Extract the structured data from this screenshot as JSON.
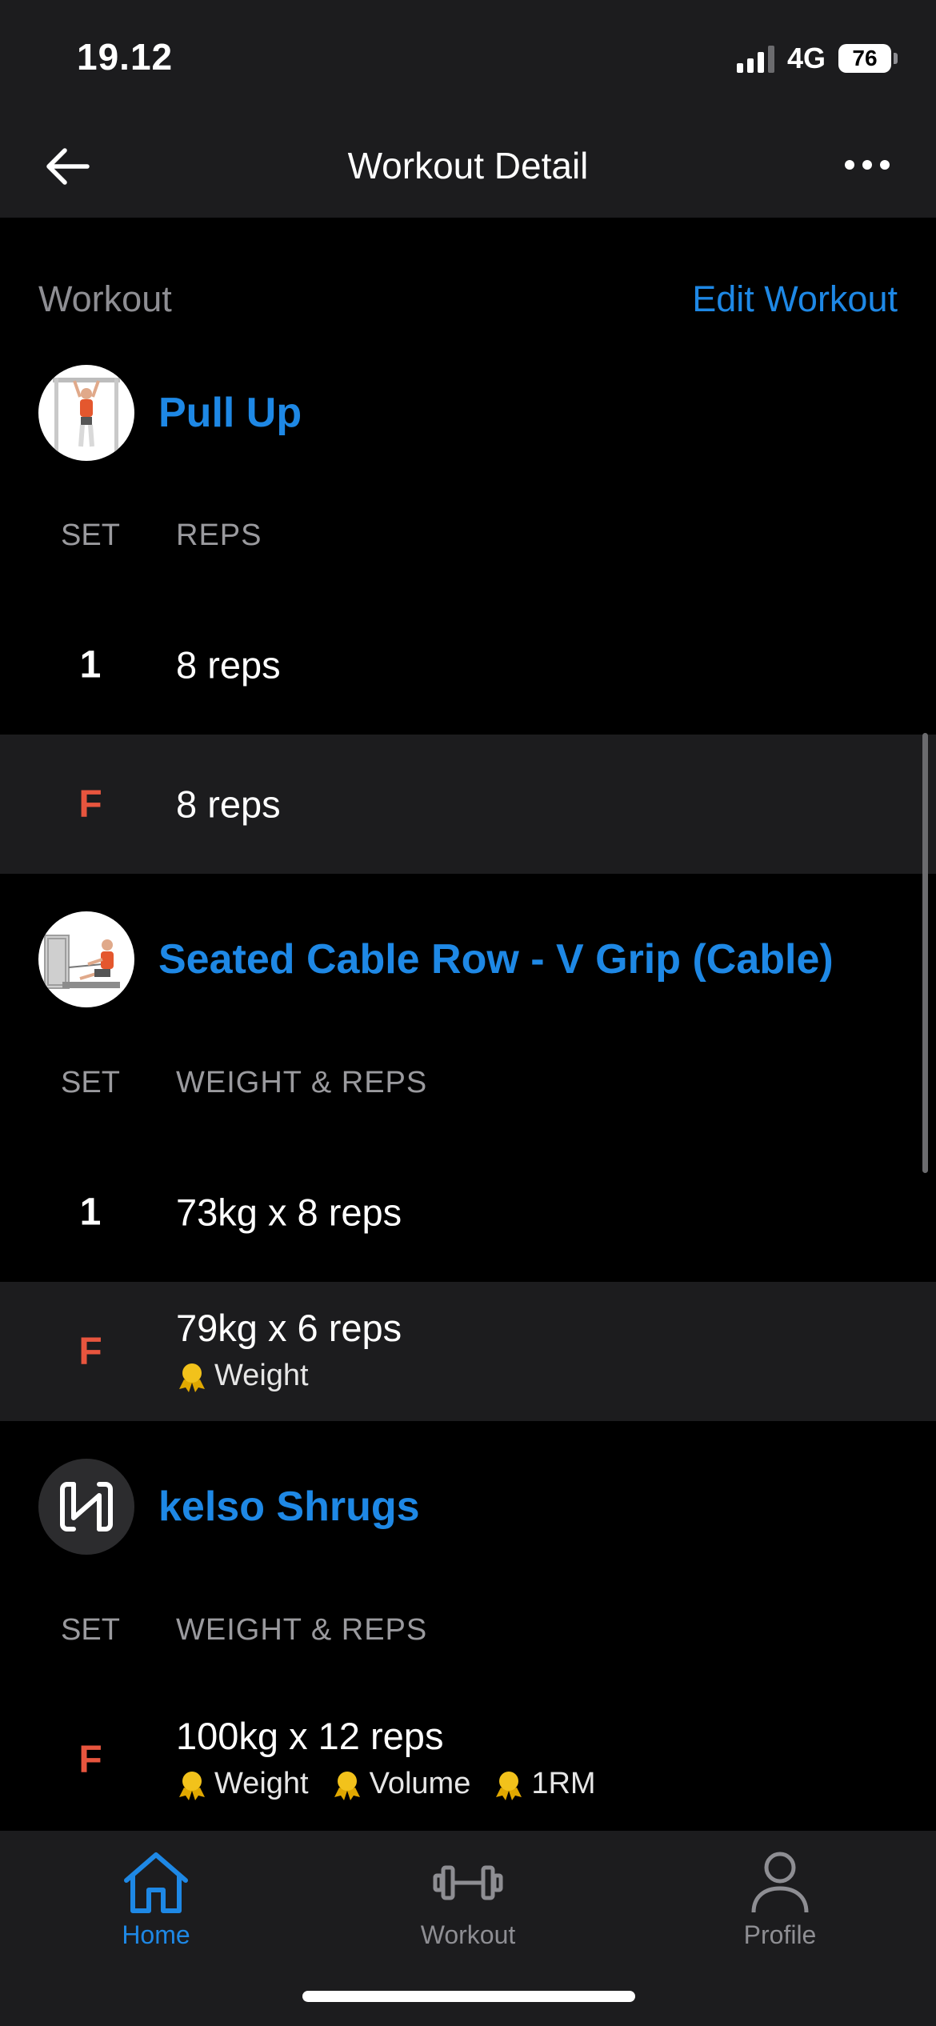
{
  "status_bar": {
    "time": "19.12",
    "network": "4G",
    "battery": "76"
  },
  "header": {
    "title": "Workout Detail"
  },
  "section": {
    "label": "Workout",
    "edit_label": "Edit Workout"
  },
  "exercises": [
    {
      "name": "Pull Up",
      "icon": "pull-up-illustration",
      "col_set": "SET",
      "col_value": "REPS",
      "sets": [
        {
          "set": "1",
          "value": "8 reps",
          "badges": []
        },
        {
          "set": "F",
          "value": "8 reps",
          "badges": []
        }
      ]
    },
    {
      "name": "Seated Cable Row - V Grip (Cable)",
      "icon": "cable-row-illustration",
      "col_set": "SET",
      "col_value": "WEIGHT & REPS",
      "sets": [
        {
          "set": "1",
          "value": "73kg x 8 reps",
          "badges": []
        },
        {
          "set": "F",
          "value": "79kg x 6 reps",
          "badges": [
            "Weight"
          ]
        }
      ]
    },
    {
      "name": "kelso Shrugs",
      "icon": "custom-exercise-icon",
      "col_set": "SET",
      "col_value": "WEIGHT & REPS",
      "sets": [
        {
          "set": "F",
          "value": "100kg x 12 reps",
          "badges": [
            "Weight",
            "Volume",
            "1RM"
          ]
        }
      ]
    }
  ],
  "tabbar": {
    "items": [
      {
        "label": "Home",
        "icon": "home-icon",
        "active": true
      },
      {
        "label": "Workout",
        "icon": "dumbbell-icon",
        "active": false
      },
      {
        "label": "Profile",
        "icon": "profile-icon",
        "active": false
      }
    ]
  },
  "colors": {
    "accent": "#1e88e5",
    "failure": "#e8553e",
    "medal": "#f2c21b",
    "bar_bg": "#1c1c1e"
  }
}
